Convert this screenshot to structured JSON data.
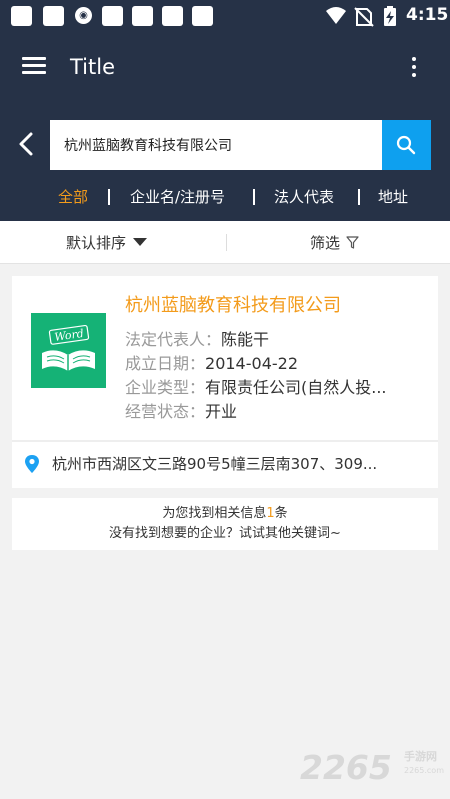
{
  "status_bar": {
    "time": "4:15",
    "colors": {
      "background": "#263247"
    },
    "icons": [
      "notification-square-icon",
      "vpn-badge-icon",
      "wifi-icon",
      "no-sim-icon",
      "battery-charging-icon"
    ]
  },
  "app_bar": {
    "title": "Title",
    "icons": [
      "menu-icon",
      "more-vert-icon"
    ]
  },
  "search": {
    "value": "杭州蓝脑教育科技有限公司",
    "icons": [
      "back-arrow-icon",
      "search-icon"
    ]
  },
  "filter_tabs": [
    {
      "label": "全部",
      "active": true
    },
    {
      "label": "企业名/注册号",
      "active": false
    },
    {
      "label": "法人代表",
      "active": false
    },
    {
      "label": "地址",
      "active": false
    }
  ],
  "sort_bar": {
    "sort_label": "默认排序",
    "filter_label": "筛选"
  },
  "result": {
    "company_name": "杭州蓝脑教育科技有限公司",
    "logo_text": "Word",
    "rows": [
      {
        "label": "法定代表人：",
        "value": "陈能干"
      },
      {
        "label": "成立日期：",
        "value": "2014-04-22"
      },
      {
        "label": "企业类型：",
        "value": "有限责任公司(自然人投..."
      },
      {
        "label": "经营状态：",
        "value": "开业"
      }
    ],
    "address": "杭州市西湖区文三路90号5幢三层南307、309..."
  },
  "summary": {
    "prefix": "为您找到相关信息",
    "count": "1",
    "suffix": "条",
    "hint": "没有找到想要的企业？试试其他关键词~"
  },
  "watermark": {
    "number": "2265",
    "cn": "手游网",
    "url": "2265.com"
  },
  "colors": {
    "header": "#263247",
    "accent_orange": "#f39b1b",
    "search_blue": "#0ea0ef",
    "logo_green": "#15b276",
    "location_blue": "#1da1f2"
  }
}
